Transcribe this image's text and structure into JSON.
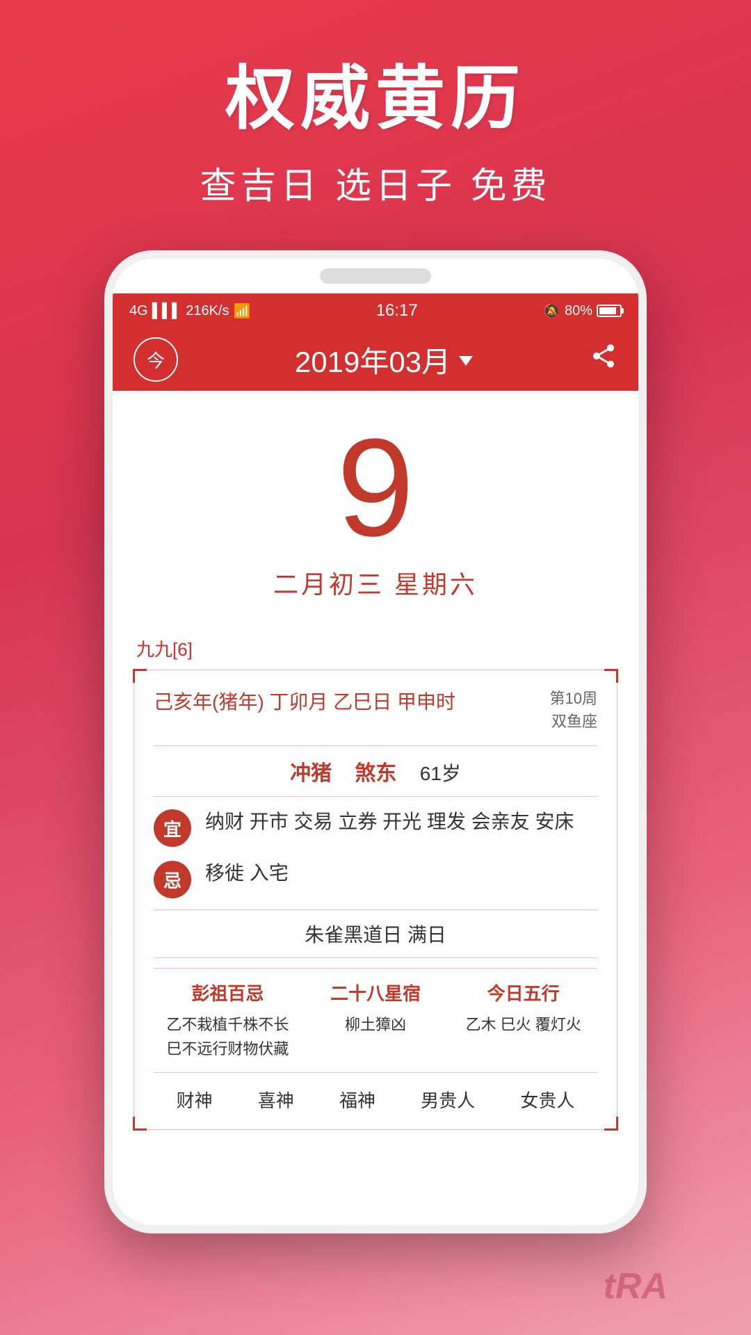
{
  "app": {
    "background_gradient_start": "#e8394a",
    "background_gradient_end": "#f0a0b0"
  },
  "top_section": {
    "main_title": "权威黄历",
    "sub_title": "查吉日 选日子 免费"
  },
  "status_bar": {
    "signal": "4G",
    "network_speed": "216K/s",
    "wifi": "WiFi",
    "time": "16:17",
    "alarm": "🔕",
    "battery_percent": "80%"
  },
  "app_header": {
    "today_label": "今",
    "month_selector": "2019年03月",
    "share_icon": "share"
  },
  "calendar": {
    "day_number": "9",
    "lunar_date": "二月初三  星期六",
    "nine_nine": "九九[6]"
  },
  "almanac": {
    "ganzhi": "己亥年(猪年) 丁卯月  乙巳日  甲申时",
    "week_label": "第10周",
    "zodiac": "双鱼座",
    "chong": "冲猪",
    "sha": "煞东",
    "age": "61岁",
    "yi_label": "宜",
    "yi_content": "纳财 开市 交易 立券 开光 理发 会亲友 安床",
    "ji_label": "忌",
    "ji_content": "移徙 入宅",
    "black_day": "朱雀黑道日  满日",
    "peng_zu_title": "彭祖百忌",
    "peng_za_content_line1": "乙不栽植千株不长",
    "peng_za_content_line2": "巳不远行财物伏藏",
    "xiu_title": "二十八星宿",
    "xiu_content": "柳土獐凶",
    "wuxing_title": "今日五行",
    "wuxing_content": "乙木 巳火 覆灯火",
    "footer_items": [
      "财神",
      "喜神",
      "福神",
      "男贵人",
      "女贵人"
    ],
    "watermark": "tRA"
  }
}
